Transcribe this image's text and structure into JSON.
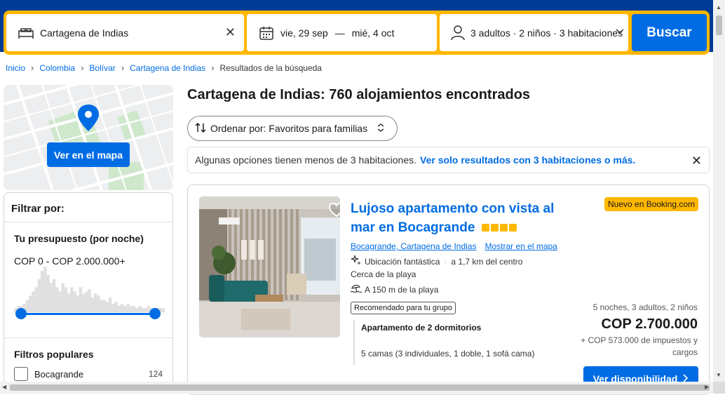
{
  "search": {
    "destination": "Cartagena de Indias",
    "checkin": "vie, 29 sep",
    "dash": "—",
    "checkout": "mié, 4 oct",
    "guests": "3 adultos · 2 niños · 3 habitaciones",
    "button": "Buscar"
  },
  "breadcrumb": [
    "Inicio",
    "Colombia",
    "Bolívar",
    "Cartagena de Indias"
  ],
  "breadcrumb_current": "Resultados de la búsqueda",
  "map": {
    "button": "Ver en el mapa"
  },
  "filters": {
    "title": "Filtrar por:",
    "budget_title": "Tu presupuesto (por noche)",
    "budget_range": "COP 0 - COP 2.000.000+",
    "histogram": [
      2,
      3,
      3,
      4,
      6,
      8,
      10,
      12,
      16,
      20,
      22,
      18,
      14,
      16,
      12,
      10,
      14,
      12,
      9,
      12,
      10,
      8,
      12,
      9,
      10,
      11,
      7,
      9,
      8,
      6,
      6,
      5,
      7,
      4,
      5,
      3,
      4,
      3,
      4,
      3,
      3,
      2,
      3,
      2,
      2,
      3,
      2,
      2,
      2,
      2,
      2
    ],
    "popular_title": "Filtros populares",
    "popular": [
      {
        "label": "Bocagrande",
        "count": "124"
      }
    ]
  },
  "results": {
    "title": "Cartagena de Indias: 760 alojamientos encontrados",
    "sort_label": "Ordenar por: Favoritos para familias"
  },
  "notice": {
    "text": "Algunas opciones tienen menos de 3 habitaciones.",
    "link": "Ver solo resultados con 3 habitaciones o más."
  },
  "card": {
    "title": "Lujoso apartamento con vista al mar en Bocagrande",
    "badge": "Nuevo en Booking.com",
    "location_link": "Bocagrande, Cartagena de Indias",
    "map_link": "Mostrar en el mapa",
    "location_score": "Ubicación fantástica",
    "distance": "a 1,7 km del centro",
    "beach_near": "Cerca de la playa",
    "beach_distance": "A 150 m de la playa",
    "recommended": "Recomendado para tu grupo",
    "room_name": "Apartamento de 2 dormitorios",
    "room_beds": "5 camas (3 individuales, 1 doble, 1 sofá cama)",
    "nights": "5 noches, 3 adultos, 2 niños",
    "price": "COP 2.700.000",
    "taxes": "+ COP 573.000 de impuestos y cargos",
    "button": "Ver disponibilidad"
  },
  "colors": {
    "brand_blue": "#003b95",
    "accent": "#006ce4",
    "yellow": "#ffb700"
  }
}
